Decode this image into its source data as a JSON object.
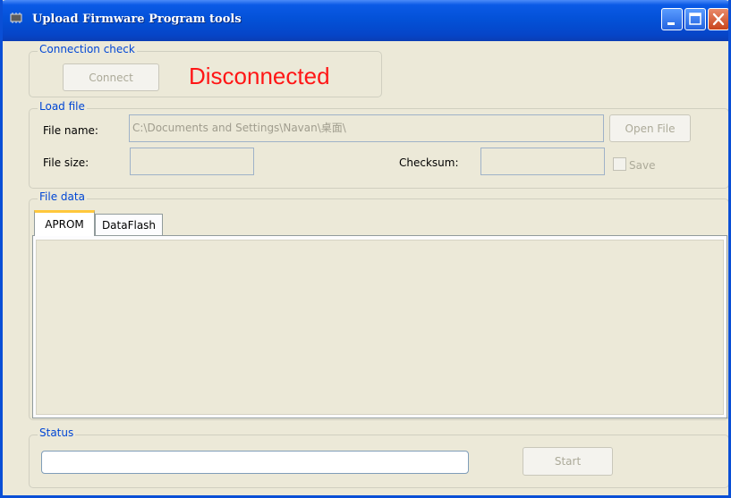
{
  "window": {
    "title": "Upload Firmware Program tools"
  },
  "connection": {
    "group_label": "Connection check",
    "connect_button": "Connect",
    "state_text": "Disconnected",
    "state_color": "#ff1616"
  },
  "load_file": {
    "group_label": "Load file",
    "file_name_label": "File name:",
    "file_name_value": "C:\\Documents and Settings\\Navan\\桌面\\",
    "open_button": "Open File",
    "file_size_label": "File size:",
    "file_size_value": "",
    "checksum_label": "Checksum:",
    "checksum_value": "",
    "save_label": "Save",
    "save_checked": false
  },
  "file_data": {
    "group_label": "File data",
    "tabs": [
      {
        "label": "APROM",
        "active": true
      },
      {
        "label": "DataFlash",
        "active": false
      }
    ]
  },
  "status": {
    "group_label": "Status",
    "progress": 0,
    "start_button": "Start"
  },
  "icons": {
    "app": "chip-icon",
    "minimize": "minimize-icon",
    "maximize": "maximize-icon",
    "close": "close-icon"
  }
}
